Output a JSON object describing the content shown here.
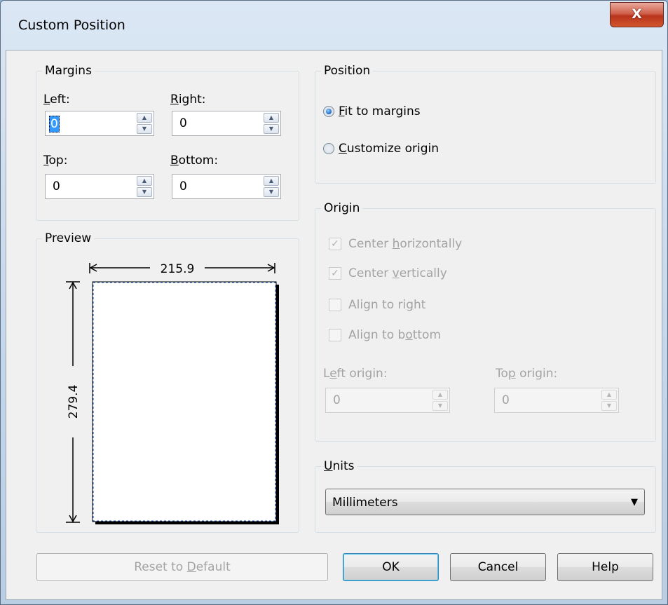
{
  "window": {
    "title": "Custom Position",
    "close_glyph": "X"
  },
  "margins": {
    "label": "Margins",
    "left_label": "Left:",
    "left_value": "0",
    "right_label": "Right:",
    "right_value": "0",
    "top_label": "Top:",
    "top_value": "0",
    "bottom_label": "Bottom:",
    "bottom_value": "0"
  },
  "position": {
    "label": "Position",
    "fit_label": "Fit to margins",
    "customize_label": "Customize origin",
    "selected": "fit"
  },
  "origin": {
    "label": "Origin",
    "center_h_label": "Center horizontally",
    "center_h_checked": true,
    "center_v_label": "Center vertically",
    "center_v_checked": true,
    "align_right_label": "Align to right",
    "align_right_checked": false,
    "align_bottom_label": "Align to bottom",
    "align_bottom_checked": false,
    "left_origin_label": "Left origin:",
    "left_origin_value": "0",
    "top_origin_label": "Top origin:",
    "top_origin_value": "0"
  },
  "preview": {
    "label": "Preview",
    "width_value": "215.9",
    "height_value": "279.4"
  },
  "units": {
    "label": "Units",
    "selected": "Millimeters"
  },
  "buttons": {
    "reset": "Reset to Default",
    "ok": "OK",
    "cancel": "Cancel",
    "help": "Help"
  },
  "colors": {
    "accent": "#3399ff",
    "disabled_text": "#a3a3a3",
    "close_red": "#c7422a"
  }
}
